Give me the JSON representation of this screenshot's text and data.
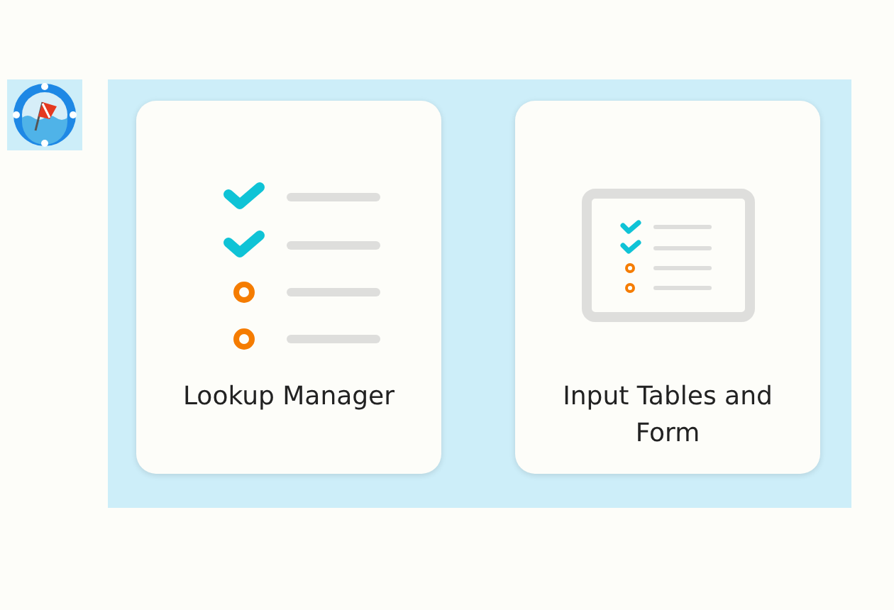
{
  "tiles": [
    {
      "label": "Lookup Manager",
      "kind": "checklist"
    },
    {
      "label": "Input Tables and Form",
      "kind": "form"
    }
  ]
}
